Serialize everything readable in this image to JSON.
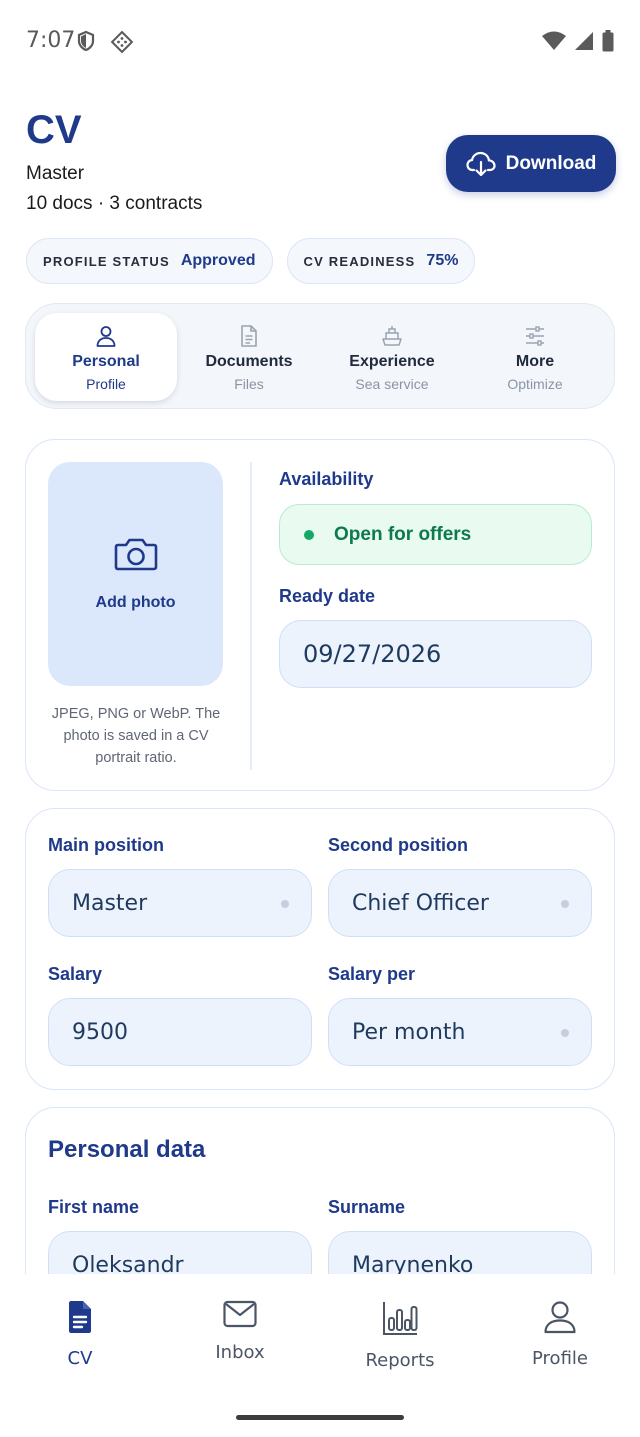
{
  "status_bar": {
    "time": "7:07"
  },
  "header": {
    "title": "CV",
    "rank": "Master",
    "meta": "10 docs · 3 contracts",
    "download_label": "Download"
  },
  "pills": [
    {
      "key": "PROFILE STATUS",
      "value": "Approved"
    },
    {
      "key": "CV READINESS",
      "value": "75%"
    }
  ],
  "tabs": [
    {
      "title": "Personal",
      "sub": "Profile",
      "icon": "person-icon",
      "active": true
    },
    {
      "title": "Documents",
      "sub": "Files",
      "icon": "document-icon",
      "active": false
    },
    {
      "title": "Experience",
      "sub": "Sea service",
      "icon": "ship-icon",
      "active": false
    },
    {
      "title": "More",
      "sub": "Optimize",
      "icon": "sliders-icon",
      "active": false
    }
  ],
  "photo": {
    "label": "Add photo",
    "help": "JPEG, PNG or WebP. The photo is saved in a CV portrait ratio."
  },
  "availability": {
    "label": "Availability",
    "value": "Open for offers",
    "status_color": "#12a866"
  },
  "ready_date": {
    "label": "Ready date",
    "value": "09/27/2026"
  },
  "positions": {
    "main_label": "Main position",
    "main_value": "Master",
    "second_label": "Second position",
    "second_value": "Chief Officer",
    "salary_label": "Salary",
    "salary_value": "9500",
    "salary_per_label": "Salary per",
    "salary_per_value": "Per month"
  },
  "personal_data": {
    "title": "Personal data",
    "first_name_label": "First name",
    "first_name_value": "Oleksandr",
    "surname_label": "Surname",
    "surname_value": "Marynenko"
  },
  "bottom_nav": [
    {
      "label": "CV",
      "icon": "cv-document-icon",
      "active": true
    },
    {
      "label": "Inbox",
      "icon": "mail-icon",
      "active": false
    },
    {
      "label": "Reports",
      "icon": "bar-chart-icon",
      "active": false
    },
    {
      "label": "Profile",
      "icon": "person-icon",
      "active": false
    }
  ],
  "colors": {
    "accent": "#1f3a8a",
    "field_bg": "#ecf3fd",
    "success": "#12a866"
  }
}
